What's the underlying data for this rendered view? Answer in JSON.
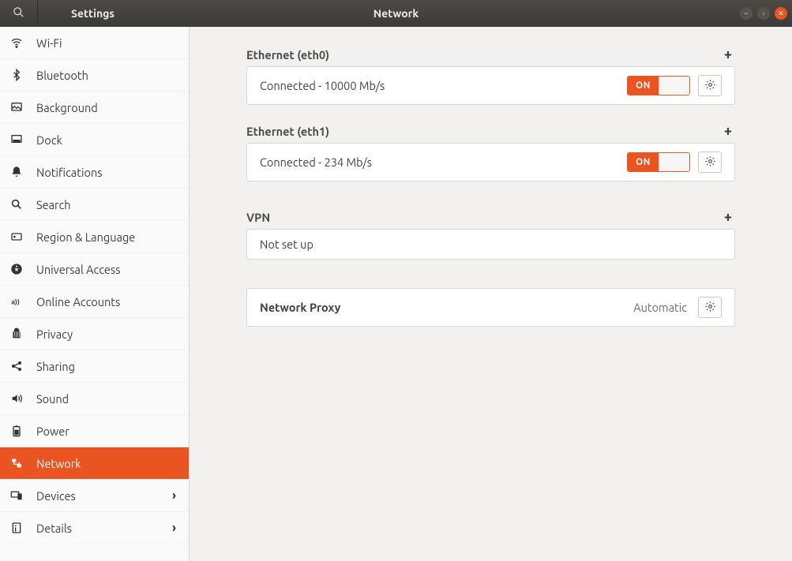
{
  "header": {
    "app_name": "Settings",
    "page_title": "Network"
  },
  "sidebar": {
    "items": [
      {
        "label": "Wi-Fi",
        "icon": "wifi"
      },
      {
        "label": "Bluetooth",
        "icon": "bluetooth"
      },
      {
        "label": "Background",
        "icon": "background"
      },
      {
        "label": "Dock",
        "icon": "dock"
      },
      {
        "label": "Notifications",
        "icon": "bell"
      },
      {
        "label": "Search",
        "icon": "search"
      },
      {
        "label": "Region & Language",
        "icon": "region"
      },
      {
        "label": "Universal Access",
        "icon": "accessibility"
      },
      {
        "label": "Online Accounts",
        "icon": "accounts"
      },
      {
        "label": "Privacy",
        "icon": "privacy"
      },
      {
        "label": "Sharing",
        "icon": "share"
      },
      {
        "label": "Sound",
        "icon": "sound"
      },
      {
        "label": "Power",
        "icon": "power"
      },
      {
        "label": "Network",
        "icon": "network",
        "selected": true
      },
      {
        "label": "Devices",
        "icon": "devices",
        "chevron": true
      },
      {
        "label": "Details",
        "icon": "details",
        "chevron": true
      }
    ]
  },
  "network": {
    "ethernet": [
      {
        "title": "Ethernet (eth0)",
        "status": "Connected - 10000 Mb/s",
        "toggle": "ON"
      },
      {
        "title": "Ethernet (eth1)",
        "status": "Connected - 234 Mb/s",
        "toggle": "ON"
      }
    ],
    "vpn": {
      "title": "VPN",
      "status": "Not set up"
    },
    "proxy": {
      "title": "Network Proxy",
      "value": "Automatic"
    }
  }
}
